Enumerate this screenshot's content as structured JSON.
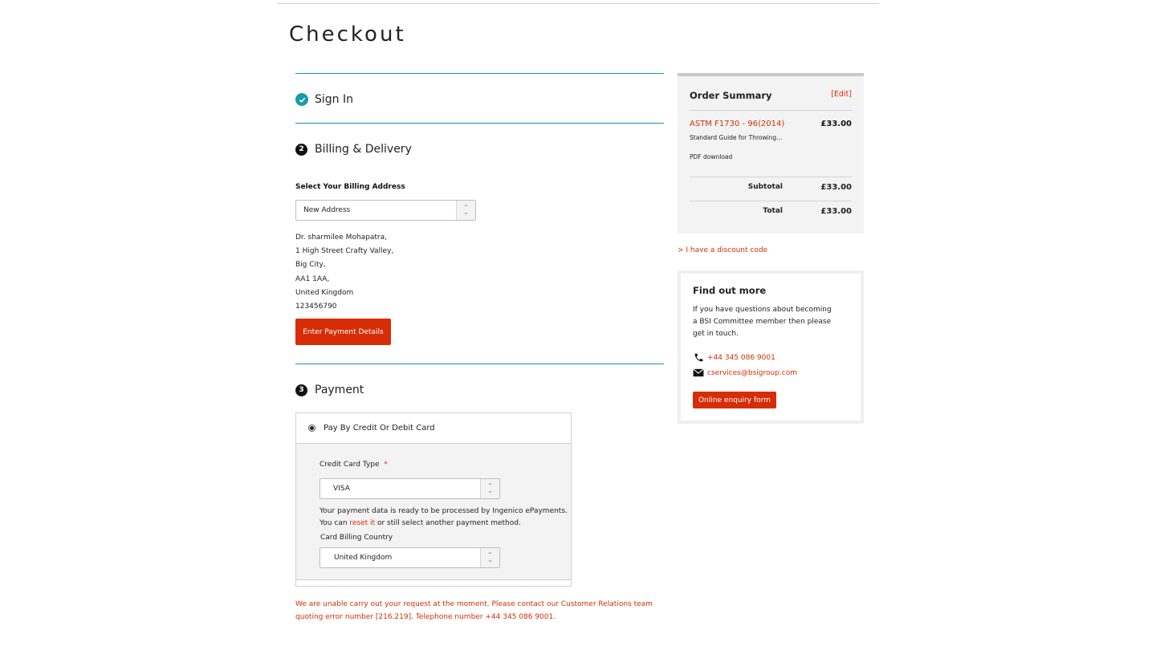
{
  "page": {
    "title": "Checkout"
  },
  "steps": {
    "sign_in": {
      "label": "Sign In"
    },
    "billing": {
      "number": "2",
      "label": "Billing & Delivery",
      "address_label": "Select Your Billing Address",
      "address_select": "New Address",
      "address_lines": [
        "Dr. sharmilee Mohapatra,",
        "1 High Street Crafty Valley,",
        "Big City,",
        "AA1 1AA,",
        "United Kingdom",
        "123456790"
      ],
      "button": "Enter Payment Details"
    },
    "payment": {
      "number": "3",
      "label": "Payment",
      "option": "Pay By Credit Or Debit Card",
      "card_type_label": "Credit Card Type",
      "required_mark": "*",
      "card_type_value": "VISA",
      "info_line1": "Your payment data is ready to be processed by Ingenico ePayments.",
      "info_line2_pre": "You can ",
      "info_line2_link": "reset it",
      "info_line2_post": " or still select another payment method.",
      "country_label": "Card Billing Country",
      "country_value": "United Kingdom"
    }
  },
  "error": "We are unable carry out your request at the moment. Please contact our Customer Relations team quoting error number [216.219]. Telephone number +44 345 086 9001.",
  "summary": {
    "title": "Order Summary",
    "edit": "[Edit]",
    "item_name": "ASTM F1730 - 96(2014)",
    "item_price": "£33.00",
    "item_desc": "Standard Guide for Throwing...",
    "item_format": "PDF download",
    "subtotal_label": "Subtotal",
    "subtotal_value": "£33.00",
    "total_label": "Total",
    "total_value": "£33.00"
  },
  "discount": "> I have a discount code",
  "find_out_more": {
    "title": "Find out more",
    "text": "If you have questions about becoming a BSI Committee member then please get in touch.",
    "phone": "+44 345 086 9001",
    "email": "cservices@bsigroup.com",
    "button": "Online enquiry form"
  },
  "colors": {
    "accent": "#d62d06",
    "rule": "#1b8fb8",
    "check": "#1a9aa8"
  },
  "icons": [
    "check-icon",
    "chevron-updown-icon",
    "phone-icon",
    "mail-icon"
  ]
}
